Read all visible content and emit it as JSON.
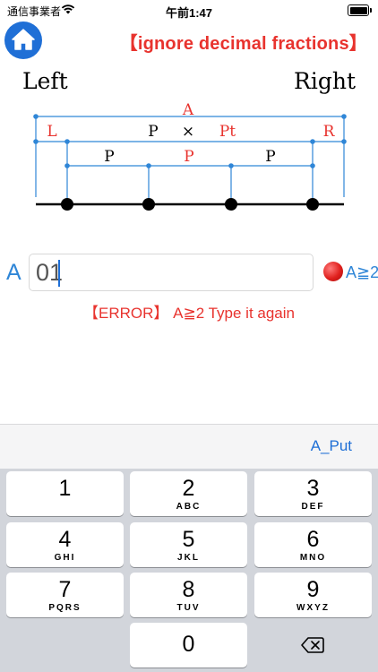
{
  "status_bar": {
    "carrier": "通信事業者",
    "time": "午前1:47"
  },
  "header": {
    "notice": "【ignore decimal fractions】"
  },
  "diagram": {
    "left_label": "Left",
    "right_label": "Right",
    "a_label": "A",
    "l_label": "L",
    "r_label": "R",
    "p_label_top": "P",
    "times_label": "×",
    "pt_label": "Pt",
    "p_left": "P",
    "p_middle": "P",
    "p_right": "P"
  },
  "input_row": {
    "label": "A",
    "value": "01",
    "condition": "A≧2"
  },
  "error_message": "【ERROR】 A≧2 Type it again",
  "toolbar": {
    "put_label": "A_Put"
  },
  "keypad": {
    "keys": [
      {
        "num": "1",
        "sub": ""
      },
      {
        "num": "2",
        "sub": "ABC"
      },
      {
        "num": "3",
        "sub": "DEF"
      },
      {
        "num": "4",
        "sub": "GHI"
      },
      {
        "num": "5",
        "sub": "JKL"
      },
      {
        "num": "6",
        "sub": "MNO"
      },
      {
        "num": "7",
        "sub": "PQRS"
      },
      {
        "num": "8",
        "sub": "TUV"
      },
      {
        "num": "9",
        "sub": "WXYZ"
      },
      {
        "num": "0",
        "sub": ""
      }
    ]
  },
  "colors": {
    "accent_blue": "#1f6fd6",
    "error_red": "#e8332e",
    "line_blue": "#2f86d7"
  }
}
